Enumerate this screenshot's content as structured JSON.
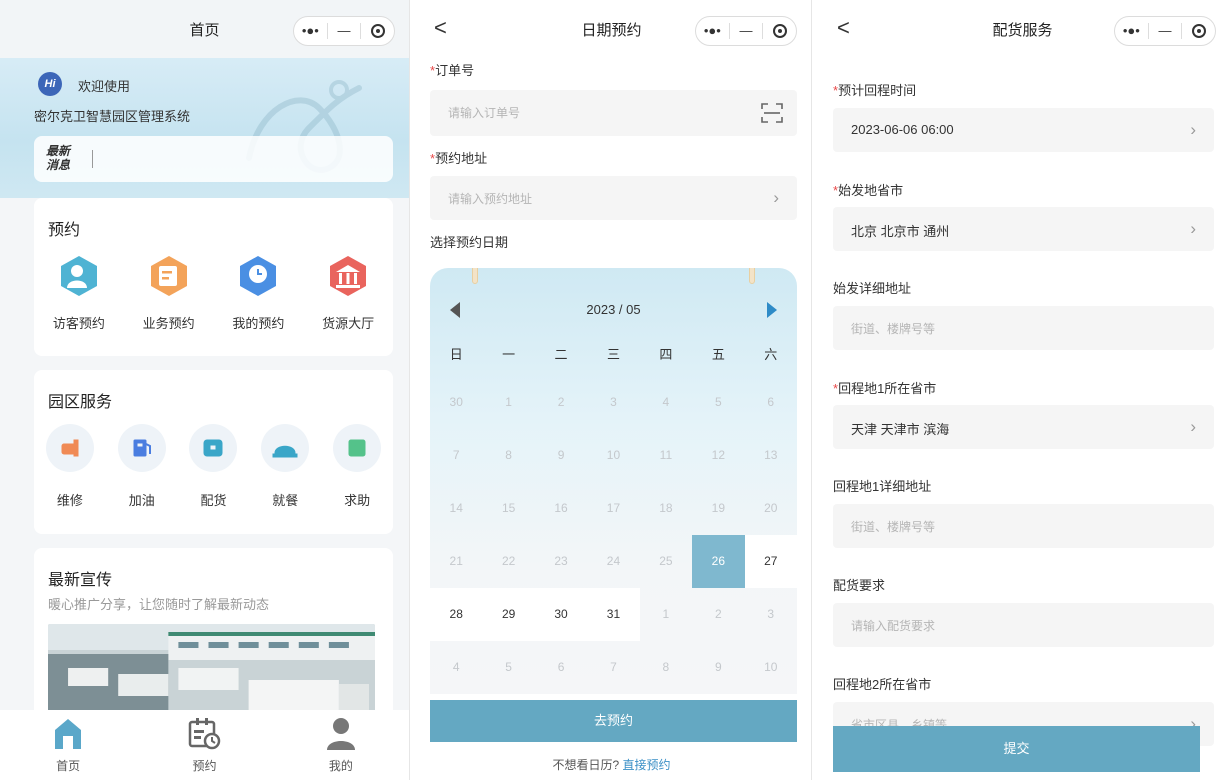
{
  "capsule": {
    "dots": "•●•",
    "minimize": "—"
  },
  "home": {
    "title": "首页",
    "hi": "Hi",
    "welcome": "欢迎使用",
    "system_name": "密尔克卫智慧园区管理系统",
    "news_tag": "最新消息",
    "booking": {
      "title": "预约",
      "items": [
        {
          "label": "访客预约",
          "color": "#4fb3d3",
          "icon": "visitor-icon"
        },
        {
          "label": "业务预约",
          "color": "#f3a35a",
          "icon": "business-icon"
        },
        {
          "label": "我的预约",
          "color": "#4a8fe3",
          "icon": "my-booking-icon"
        },
        {
          "label": "货源大厅",
          "color": "#e9645d",
          "icon": "hall-icon"
        }
      ]
    },
    "services": {
      "title": "园区服务",
      "items": [
        {
          "label": "维修",
          "color": "#f08a55",
          "icon": "repair-icon"
        },
        {
          "label": "加油",
          "color": "#4a7de0",
          "icon": "fuel-icon"
        },
        {
          "label": "配货",
          "color": "#3aa6c8",
          "icon": "cargo-icon"
        },
        {
          "label": "就餐",
          "color": "#3aa6c8",
          "icon": "dining-icon"
        },
        {
          "label": "求助",
          "color": "#54c28a",
          "icon": "help-icon"
        }
      ]
    },
    "promo": {
      "title": "最新宣传",
      "subtitle": "暖心推广分享，让您随时了解最新动态"
    },
    "tabs": [
      {
        "label": "首页",
        "icon": "home-icon"
      },
      {
        "label": "预约",
        "icon": "calendar-icon"
      },
      {
        "label": "我的",
        "icon": "user-icon"
      }
    ]
  },
  "booking_page": {
    "title": "日期预约",
    "back": "<",
    "order_label": "订单号",
    "order_placeholder": "请输入订单号",
    "address_label": "预约地址",
    "address_placeholder": "请输入预约地址",
    "date_label": "选择预约日期",
    "month": "2023 / 05",
    "weekdays": [
      "日",
      "一",
      "二",
      "三",
      "四",
      "五",
      "六"
    ],
    "days": [
      [
        "30",
        "1",
        "2",
        "3",
        "4",
        "5",
        "6"
      ],
      [
        "7",
        "8",
        "9",
        "10",
        "11",
        "12",
        "13"
      ],
      [
        "14",
        "15",
        "16",
        "17",
        "18",
        "19",
        "20"
      ],
      [
        "21",
        "22",
        "23",
        "24",
        "25",
        "26",
        "27"
      ],
      [
        "28",
        "29",
        "30",
        "31",
        "1",
        "2",
        "3"
      ],
      [
        "4",
        "5",
        "6",
        "7",
        "8",
        "9",
        "10"
      ]
    ],
    "selected_day": "26",
    "book_button": "去预约",
    "footer_text": "不想看日历?",
    "footer_link": "直接预约"
  },
  "delivery_page": {
    "title": "配货服务",
    "back": "<",
    "return_time_label": "预计回程时间",
    "return_time_value": "2023-06-06 06:00",
    "origin_city_label": "始发地省市",
    "origin_city_value": "北京 北京市 通州",
    "origin_detail_label": "始发详细地址",
    "origin_detail_placeholder": "街道、楼牌号等",
    "return1_city_label": "回程地1所在省市",
    "return1_city_value": "天津 天津市 滨海",
    "return1_detail_label": "回程地1详细地址",
    "return1_detail_placeholder": "街道、楼牌号等",
    "requirement_label": "配货要求",
    "requirement_placeholder": "请输入配货要求",
    "return2_city_label": "回程地2所在省市",
    "return2_city_placeholder": "省市区县、乡镇等",
    "submit": "提交"
  }
}
